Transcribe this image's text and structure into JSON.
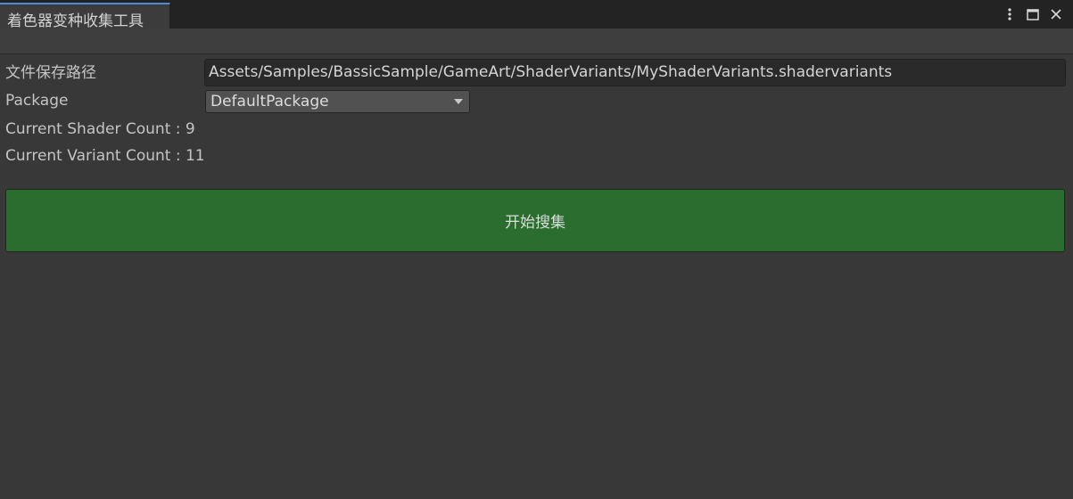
{
  "tab": {
    "title": "着色器变种收集工具"
  },
  "window_controls": {
    "icons": [
      "more-vertical-icon",
      "maximize-icon",
      "close-icon"
    ]
  },
  "form": {
    "save_path_label": "文件保存路径",
    "save_path_value": "Assets/Samples/BassicSample/GameArt/ShaderVariants/MyShaderVariants.shadervariants",
    "package_label": "Package",
    "package_selected": "DefaultPackage",
    "shader_count_text": "Current Shader Count : 9",
    "variant_count_text": "Current Variant Count : 11"
  },
  "actions": {
    "collect_button_label": "开始搜集"
  },
  "colors": {
    "background": "#383838",
    "button_green": "#2a6d2f",
    "tab_accent": "#4e8ad6"
  }
}
